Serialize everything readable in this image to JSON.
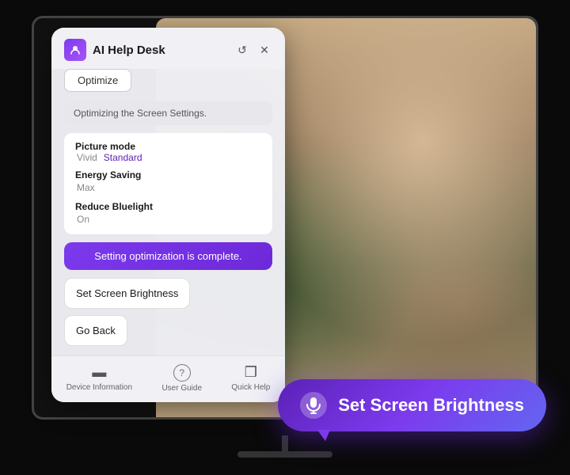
{
  "app": {
    "title": "AI Help Desk",
    "optimize_btn": "Optimize",
    "status_text": "Optimizing the Screen Settings.",
    "reset_icon": "↺",
    "close_icon": "✕"
  },
  "settings": {
    "items": [
      {
        "name": "Picture mode",
        "value": "Vivid",
        "value_active": "Standard"
      },
      {
        "name": "Energy Saving",
        "value": "Max",
        "value_active": null
      },
      {
        "name": "Reduce Bluelight",
        "value": "On",
        "value_active": null
      }
    ]
  },
  "completion_message": "Setting optimization is complete.",
  "actions": [
    {
      "label": "Set Screen Brightness"
    },
    {
      "label": "Go Back"
    }
  ],
  "footer": {
    "items": [
      {
        "label": "Device Information",
        "icon": "▬"
      },
      {
        "label": "User Guide",
        "icon": "?"
      },
      {
        "label": "Quick Help",
        "icon": "❒"
      }
    ]
  },
  "voice_bubble": {
    "text": "Set Screen Brightness",
    "mic_icon": "🎤"
  }
}
